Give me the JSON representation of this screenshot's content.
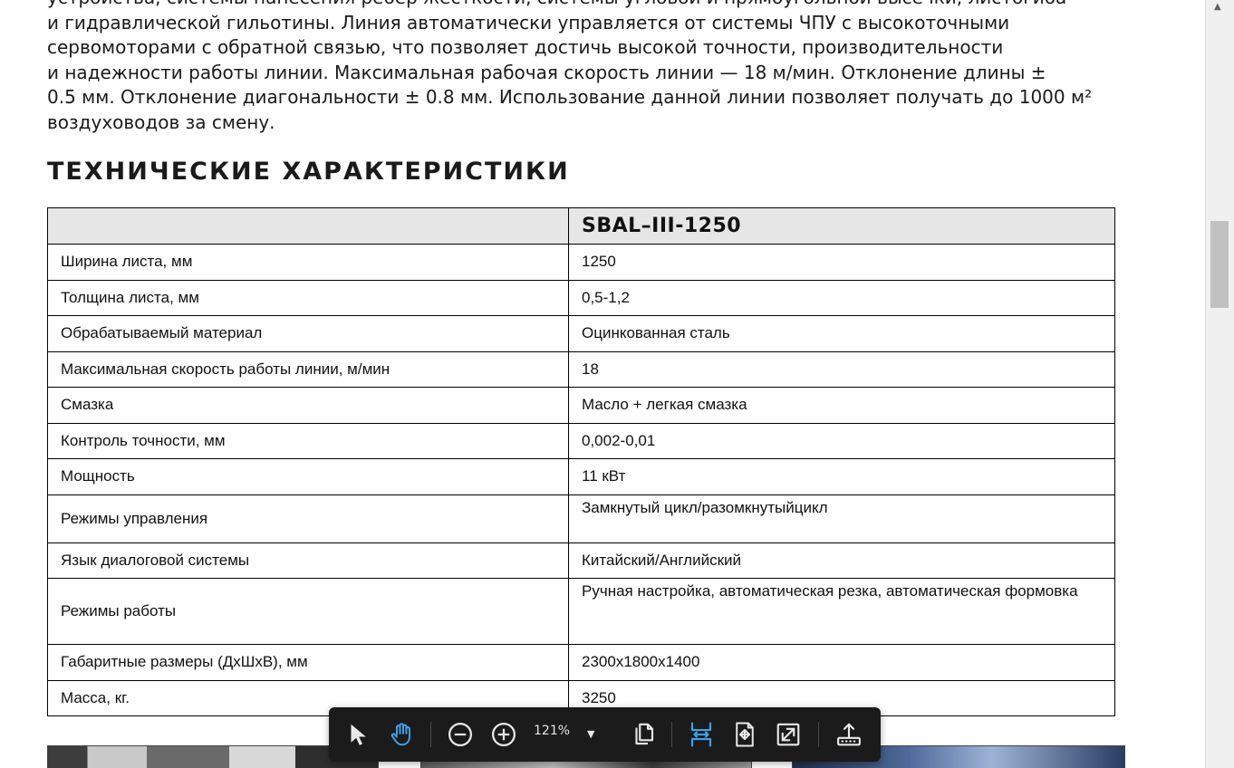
{
  "document": {
    "intro_lines": [
      "устройства, системы нанесения ребер жесткости, системы угловой и прямоугольной высечки, листогиба",
      "и гидравлической гильотины. Линия автоматически управляется от системы ЧПУ с высокоточными",
      "сервомоторами с обратной связью, что позволяет достичь высокой точности, производительности",
      "и надежности работы линии. Максимальная рабочая скорость линии — 18 м/мин. Отклонение длины ±",
      "0.5 мм. Отклонение диагональности ± 0.8 мм. Использование данной линии позволяет получать до 1000 м²",
      "воздуховодов за смену."
    ],
    "section_title": "ТЕХНИЧЕСКИЕ  ХАРАКТЕРИСТИКИ",
    "table": {
      "header": [
        "",
        "SBAL–III-1250"
      ],
      "rows": [
        [
          "Ширина листа, мм",
          "1250"
        ],
        [
          "Толщина листа, мм",
          "0,5-1,2"
        ],
        [
          "Обрабатываемый материал",
          "Оцинкованная сталь"
        ],
        [
          "Максимальная скорость работы линии, м/мин",
          "18"
        ],
        [
          "Смазка",
          "Масло + легкая смазка"
        ],
        [
          "Контроль точности, мм",
          "0,002-0,01"
        ],
        [
          "Мощность",
          "11 кВт"
        ],
        [
          "Режимы управления",
          "Замкнутый цикл/разомкнутыйцикл"
        ],
        [
          "Язык диалоговой системы",
          "Китайский/Английский"
        ],
        [
          "Режимы работы",
          "Ручная настройка, автоматическая резка, автоматическая формовка"
        ],
        [
          "Габаритные размеры (ДхШхВ), мм",
          "2300х1800х1400"
        ],
        [
          "Масса, кг.",
          "3250"
        ]
      ]
    }
  },
  "toolbar": {
    "zoom": "121%",
    "icons": [
      "select-cursor-icon",
      "hand-tool-icon",
      "zoom-out-icon",
      "zoom-in-icon",
      "zoom-dropdown-icon",
      "page-view-icon",
      "fit-width-icon",
      "fit-page-icon",
      "fullscreen-icon",
      "share-icon"
    ],
    "accent_color": "#3aa3f0",
    "icon_color": "#e8e8e8",
    "background_color": "#1b1b1b"
  }
}
